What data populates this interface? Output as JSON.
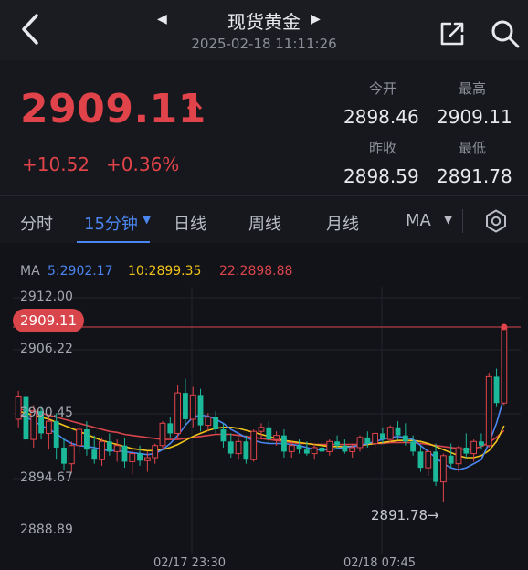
{
  "header": {
    "title": "现货黄金",
    "datetime": "2025-02-18 11:11:26"
  },
  "quote": {
    "price": "2909.11",
    "change": "+10.52",
    "change_pct": "+0.36%",
    "open_label": "今开",
    "open": "2898.46",
    "high_label": "最高",
    "high": "2909.11",
    "prev_close_label": "昨收",
    "prev_close": "2898.59",
    "low_label": "最低",
    "low": "2891.78"
  },
  "tabs": {
    "items": [
      "分时",
      "15分钟",
      "日线",
      "周线",
      "月线",
      "MA"
    ],
    "active": "15分钟"
  },
  "ma_legend": {
    "label": "MA",
    "ma5": "5:2902.17",
    "ma10": "10:2899.35",
    "ma22": "22:2898.88"
  },
  "colors": {
    "up": "#e0444a",
    "down": "#1bb89a",
    "ma5": "#4b86f0",
    "ma10": "#f0c419",
    "ma22": "#d8454b",
    "accent": "#4b86f0"
  },
  "chart_data": {
    "type": "candlestick",
    "y_ticks": [
      "2912.00",
      "2906.22",
      "2900.45",
      "2894.67",
      "2888.89"
    ],
    "y_range": [
      2888.89,
      2912.0
    ],
    "x_labels": [
      "02/17 23:30",
      "02/18 07:45"
    ],
    "current_price_tag": "2909.11",
    "low_marker": "2891.78→",
    "grid": true,
    "candles": [
      [
        2900.0,
        2902.8,
        2899.2,
        2902.2
      ],
      [
        2902.2,
        2902.6,
        2897.4,
        2898.0
      ],
      [
        2898.0,
        2901.4,
        2897.2,
        2900.8
      ],
      [
        2900.8,
        2901.2,
        2898.0,
        2898.6
      ],
      [
        2898.6,
        2900.4,
        2897.0,
        2899.8
      ],
      [
        2899.8,
        2900.6,
        2896.0,
        2897.2
      ],
      [
        2897.2,
        2898.2,
        2895.0,
        2895.6
      ],
      [
        2895.6,
        2897.8,
        2894.8,
        2897.4
      ],
      [
        2897.4,
        2899.4,
        2896.6,
        2899.0
      ],
      [
        2899.0,
        2899.8,
        2896.4,
        2897.0
      ],
      [
        2897.0,
        2898.4,
        2895.6,
        2896.0
      ],
      [
        2896.0,
        2898.2,
        2895.4,
        2897.8
      ],
      [
        2897.8,
        2898.6,
        2896.4,
        2896.8
      ],
      [
        2896.8,
        2898.0,
        2895.8,
        2897.4
      ],
      [
        2897.4,
        2898.2,
        2895.2,
        2895.8
      ],
      [
        2895.8,
        2897.0,
        2894.6,
        2896.6
      ],
      [
        2896.6,
        2897.4,
        2895.4,
        2895.9
      ],
      [
        2895.9,
        2896.8,
        2894.8,
        2896.2
      ],
      [
        2896.2,
        2897.6,
        2895.6,
        2897.4
      ],
      [
        2897.4,
        2899.8,
        2897.0,
        2899.6
      ],
      [
        2899.6,
        2900.2,
        2898.2,
        2898.6
      ],
      [
        2898.6,
        2903.4,
        2898.2,
        2902.6
      ],
      [
        2902.6,
        2904.0,
        2899.4,
        2900.0
      ],
      [
        2900.0,
        2903.2,
        2899.2,
        2902.4
      ],
      [
        2902.4,
        2903.0,
        2898.8,
        2899.4
      ],
      [
        2899.4,
        2900.6,
        2898.8,
        2900.2
      ],
      [
        2900.2,
        2900.8,
        2898.6,
        2899.0
      ],
      [
        2899.0,
        2899.6,
        2897.2,
        2897.8
      ],
      [
        2897.8,
        2898.6,
        2896.2,
        2896.6
      ],
      [
        2896.6,
        2898.2,
        2896.0,
        2897.8
      ],
      [
        2897.8,
        2898.4,
        2895.6,
        2896.0
      ],
      [
        2896.0,
        2899.0,
        2895.8,
        2898.8
      ],
      [
        2898.8,
        2899.6,
        2898.0,
        2899.2
      ],
      [
        2899.2,
        2899.8,
        2897.6,
        2898.0
      ],
      [
        2898.0,
        2898.8,
        2897.4,
        2898.4
      ],
      [
        2898.4,
        2899.0,
        2896.2,
        2896.8
      ],
      [
        2896.8,
        2897.8,
        2896.2,
        2897.4
      ],
      [
        2897.4,
        2898.0,
        2896.6,
        2897.0
      ],
      [
        2897.0,
        2897.8,
        2896.4,
        2896.6
      ],
      [
        2896.6,
        2897.6,
        2896.0,
        2897.2
      ],
      [
        2897.2,
        2898.0,
        2896.4,
        2896.8
      ],
      [
        2896.8,
        2898.0,
        2896.4,
        2897.8
      ],
      [
        2897.8,
        2898.4,
        2897.0,
        2897.4
      ],
      [
        2897.4,
        2898.0,
        2896.6,
        2896.8
      ],
      [
        2896.8,
        2897.6,
        2896.2,
        2897.2
      ],
      [
        2897.2,
        2898.4,
        2896.8,
        2898.2
      ],
      [
        2898.2,
        2898.8,
        2897.2,
        2897.6
      ],
      [
        2897.6,
        2898.8,
        2897.0,
        2898.6
      ],
      [
        2898.6,
        2899.2,
        2897.6,
        2898.0
      ],
      [
        2898.0,
        2899.4,
        2897.6,
        2899.2
      ],
      [
        2899.2,
        2899.8,
        2898.0,
        2898.4
      ],
      [
        2898.4,
        2899.6,
        2897.4,
        2897.8
      ],
      [
        2897.8,
        2898.4,
        2896.4,
        2896.8
      ],
      [
        2896.8,
        2897.4,
        2894.8,
        2895.2
      ],
      [
        2895.2,
        2897.0,
        2894.4,
        2896.8
      ],
      [
        2896.8,
        2897.6,
        2893.4,
        2893.8
      ],
      [
        2893.8,
        2896.6,
        2891.78,
        2896.4
      ],
      [
        2896.4,
        2897.6,
        2895.2,
        2895.6
      ],
      [
        2895.6,
        2897.4,
        2894.8,
        2897.2
      ],
      [
        2897.2,
        2898.6,
        2896.2,
        2896.6
      ],
      [
        2896.6,
        2898.0,
        2895.8,
        2897.8
      ],
      [
        2897.8,
        2898.6,
        2897.0,
        2897.4
      ],
      [
        2897.4,
        2904.6,
        2897.2,
        2904.2
      ],
      [
        2904.2,
        2905.0,
        2901.2,
        2901.6
      ],
      [
        2901.6,
        2909.11,
        2901.4,
        2909.11
      ]
    ],
    "ma5": [
      2900.6,
      2900.2,
      2899.8,
      2899.4,
      2899.0,
      2898.6,
      2898.0,
      2897.6,
      2897.4,
      2897.3,
      2897.2,
      2897.0,
      2896.9,
      2896.9,
      2896.8,
      2896.7,
      2896.6,
      2896.5,
      2896.6,
      2897.0,
      2897.6,
      2898.4,
      2899.4,
      2900.2,
      2900.4,
      2900.3,
      2900.0,
      2899.6,
      2899.0,
      2898.6,
      2898.2,
      2897.9,
      2897.7,
      2897.6,
      2897.6,
      2897.6,
      2897.5,
      2897.4,
      2897.2,
      2897.0,
      2897.0,
      2897.0,
      2897.1,
      2897.2,
      2897.3,
      2897.4,
      2897.6,
      2897.8,
      2898.0,
      2898.2,
      2898.3,
      2898.2,
      2898.0,
      2897.4,
      2896.8,
      2896.2,
      2895.6,
      2895.2,
      2895.0,
      2895.2,
      2895.6,
      2896.0,
      2897.6,
      2899.6,
      2902.17
    ],
    "ma10": [
      2900.8,
      2900.6,
      2900.4,
      2900.2,
      2900.0,
      2899.7,
      2899.4,
      2899.1,
      2898.8,
      2898.5,
      2898.2,
      2897.9,
      2897.7,
      2897.5,
      2897.3,
      2897.1,
      2897.0,
      2896.9,
      2896.9,
      2897.0,
      2897.2,
      2897.5,
      2897.9,
      2898.3,
      2898.6,
      2898.9,
      2899.1,
      2899.2,
      2899.2,
      2899.1,
      2898.9,
      2898.7,
      2898.5,
      2898.3,
      2898.1,
      2897.9,
      2897.8,
      2897.7,
      2897.6,
      2897.5,
      2897.4,
      2897.3,
      2897.3,
      2897.3,
      2897.3,
      2897.4,
      2897.5,
      2897.6,
      2897.7,
      2897.8,
      2897.9,
      2897.9,
      2897.9,
      2897.8,
      2897.6,
      2897.3,
      2897.0,
      2896.7,
      2896.4,
      2896.2,
      2896.2,
      2896.4,
      2896.9,
      2897.8,
      2899.35
    ],
    "ma22": [
      2901.0,
      2900.9,
      2900.8,
      2900.6,
      2900.4,
      2900.2,
      2900.0,
      2899.8,
      2899.6,
      2899.4,
      2899.2,
      2899.0,
      2898.8,
      2898.7,
      2898.5,
      2898.4,
      2898.3,
      2898.2,
      2898.1,
      2898.0,
      2898.0,
      2898.0,
      2898.1,
      2898.2,
      2898.3,
      2898.4,
      2898.5,
      2898.5,
      2898.5,
      2898.4,
      2898.3,
      2898.2,
      2898.1,
      2898.0,
      2897.9,
      2897.8,
      2897.7,
      2897.6,
      2897.6,
      2897.5,
      2897.5,
      2897.5,
      2897.5,
      2897.5,
      2897.5,
      2897.5,
      2897.5,
      2897.6,
      2897.6,
      2897.7,
      2897.7,
      2897.7,
      2897.7,
      2897.6,
      2897.5,
      2897.4,
      2897.3,
      2897.2,
      2897.1,
      2897.0,
      2897.1,
      2897.3,
      2897.7,
      2898.2,
      2898.88
    ]
  }
}
